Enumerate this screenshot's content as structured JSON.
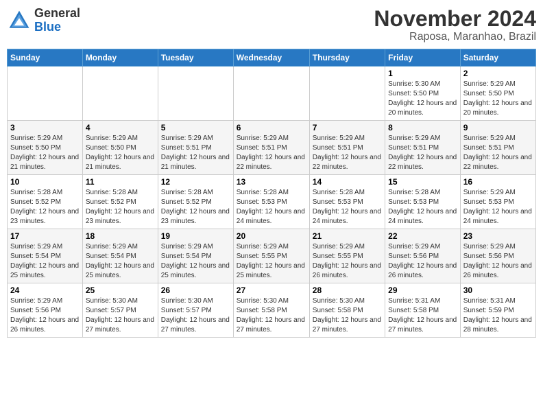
{
  "logo": {
    "general": "General",
    "blue": "Blue"
  },
  "title": "November 2024",
  "subtitle": "Raposa, Maranhao, Brazil",
  "days_header": [
    "Sunday",
    "Monday",
    "Tuesday",
    "Wednesday",
    "Thursday",
    "Friday",
    "Saturday"
  ],
  "weeks": [
    [
      {
        "day": "",
        "info": ""
      },
      {
        "day": "",
        "info": ""
      },
      {
        "day": "",
        "info": ""
      },
      {
        "day": "",
        "info": ""
      },
      {
        "day": "",
        "info": ""
      },
      {
        "day": "1",
        "info": "Sunrise: 5:30 AM\nSunset: 5:50 PM\nDaylight: 12 hours and 20 minutes."
      },
      {
        "day": "2",
        "info": "Sunrise: 5:29 AM\nSunset: 5:50 PM\nDaylight: 12 hours and 20 minutes."
      }
    ],
    [
      {
        "day": "3",
        "info": "Sunrise: 5:29 AM\nSunset: 5:50 PM\nDaylight: 12 hours and 21 minutes."
      },
      {
        "day": "4",
        "info": "Sunrise: 5:29 AM\nSunset: 5:50 PM\nDaylight: 12 hours and 21 minutes."
      },
      {
        "day": "5",
        "info": "Sunrise: 5:29 AM\nSunset: 5:51 PM\nDaylight: 12 hours and 21 minutes."
      },
      {
        "day": "6",
        "info": "Sunrise: 5:29 AM\nSunset: 5:51 PM\nDaylight: 12 hours and 22 minutes."
      },
      {
        "day": "7",
        "info": "Sunrise: 5:29 AM\nSunset: 5:51 PM\nDaylight: 12 hours and 22 minutes."
      },
      {
        "day": "8",
        "info": "Sunrise: 5:29 AM\nSunset: 5:51 PM\nDaylight: 12 hours and 22 minutes."
      },
      {
        "day": "9",
        "info": "Sunrise: 5:29 AM\nSunset: 5:51 PM\nDaylight: 12 hours and 22 minutes."
      }
    ],
    [
      {
        "day": "10",
        "info": "Sunrise: 5:28 AM\nSunset: 5:52 PM\nDaylight: 12 hours and 23 minutes."
      },
      {
        "day": "11",
        "info": "Sunrise: 5:28 AM\nSunset: 5:52 PM\nDaylight: 12 hours and 23 minutes."
      },
      {
        "day": "12",
        "info": "Sunrise: 5:28 AM\nSunset: 5:52 PM\nDaylight: 12 hours and 23 minutes."
      },
      {
        "day": "13",
        "info": "Sunrise: 5:28 AM\nSunset: 5:53 PM\nDaylight: 12 hours and 24 minutes."
      },
      {
        "day": "14",
        "info": "Sunrise: 5:28 AM\nSunset: 5:53 PM\nDaylight: 12 hours and 24 minutes."
      },
      {
        "day": "15",
        "info": "Sunrise: 5:28 AM\nSunset: 5:53 PM\nDaylight: 12 hours and 24 minutes."
      },
      {
        "day": "16",
        "info": "Sunrise: 5:29 AM\nSunset: 5:53 PM\nDaylight: 12 hours and 24 minutes."
      }
    ],
    [
      {
        "day": "17",
        "info": "Sunrise: 5:29 AM\nSunset: 5:54 PM\nDaylight: 12 hours and 25 minutes."
      },
      {
        "day": "18",
        "info": "Sunrise: 5:29 AM\nSunset: 5:54 PM\nDaylight: 12 hours and 25 minutes."
      },
      {
        "day": "19",
        "info": "Sunrise: 5:29 AM\nSunset: 5:54 PM\nDaylight: 12 hours and 25 minutes."
      },
      {
        "day": "20",
        "info": "Sunrise: 5:29 AM\nSunset: 5:55 PM\nDaylight: 12 hours and 25 minutes."
      },
      {
        "day": "21",
        "info": "Sunrise: 5:29 AM\nSunset: 5:55 PM\nDaylight: 12 hours and 26 minutes."
      },
      {
        "day": "22",
        "info": "Sunrise: 5:29 AM\nSunset: 5:56 PM\nDaylight: 12 hours and 26 minutes."
      },
      {
        "day": "23",
        "info": "Sunrise: 5:29 AM\nSunset: 5:56 PM\nDaylight: 12 hours and 26 minutes."
      }
    ],
    [
      {
        "day": "24",
        "info": "Sunrise: 5:29 AM\nSunset: 5:56 PM\nDaylight: 12 hours and 26 minutes."
      },
      {
        "day": "25",
        "info": "Sunrise: 5:30 AM\nSunset: 5:57 PM\nDaylight: 12 hours and 27 minutes."
      },
      {
        "day": "26",
        "info": "Sunrise: 5:30 AM\nSunset: 5:57 PM\nDaylight: 12 hours and 27 minutes."
      },
      {
        "day": "27",
        "info": "Sunrise: 5:30 AM\nSunset: 5:58 PM\nDaylight: 12 hours and 27 minutes."
      },
      {
        "day": "28",
        "info": "Sunrise: 5:30 AM\nSunset: 5:58 PM\nDaylight: 12 hours and 27 minutes."
      },
      {
        "day": "29",
        "info": "Sunrise: 5:31 AM\nSunset: 5:58 PM\nDaylight: 12 hours and 27 minutes."
      },
      {
        "day": "30",
        "info": "Sunrise: 5:31 AM\nSunset: 5:59 PM\nDaylight: 12 hours and 28 minutes."
      }
    ]
  ]
}
